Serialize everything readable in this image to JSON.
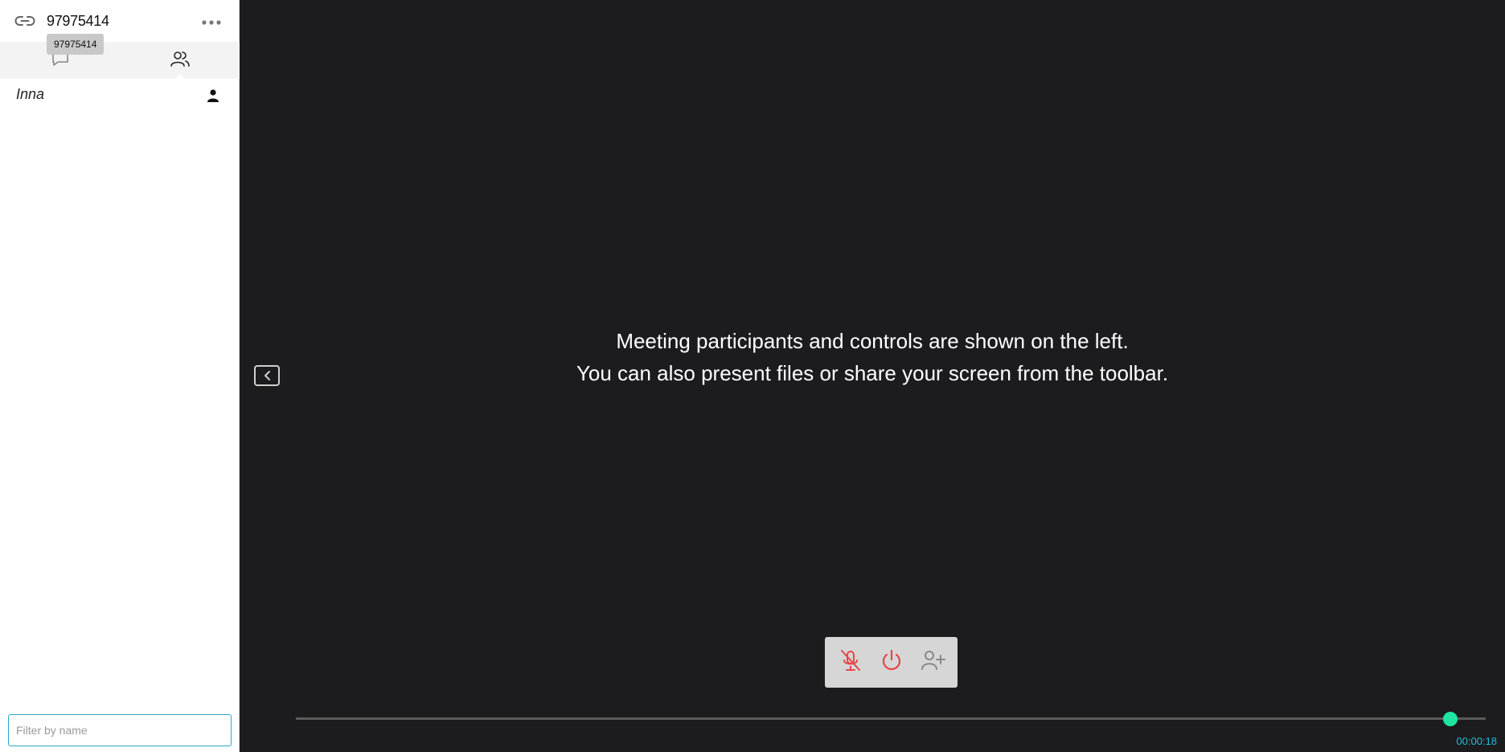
{
  "sidebar": {
    "meeting_id": "97975414",
    "tooltip": "97975414",
    "tabs": [
      {
        "name": "chat",
        "icon": "chat-icon"
      },
      {
        "name": "participants",
        "icon": "participants-icon",
        "active": true
      }
    ],
    "participants": [
      {
        "name": "Inna",
        "icon": "user-icon"
      }
    ],
    "filter": {
      "placeholder": "Filter by name",
      "value": ""
    }
  },
  "stage": {
    "message_line1": "Meeting participants and controls are shown on the left.",
    "message_line2": "You can also present files or share your screen from the toolbar.",
    "toolbar": {
      "buttons": [
        "mic-muted-icon",
        "power-icon",
        "add-user-icon"
      ]
    },
    "timeline": {
      "progress": 0.97,
      "time": "00:00:18"
    }
  },
  "colors": {
    "stage_bg": "#1c1c1e",
    "muted_red": "#e64646",
    "timeline_thumb": "#1ee6a0",
    "timer": "#1ec0d8",
    "filter_border": "#2aa8c9"
  }
}
